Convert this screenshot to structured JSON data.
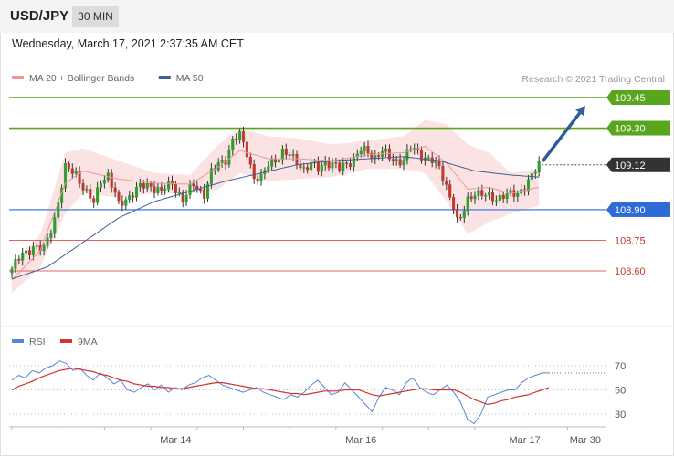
{
  "header": {
    "pair": "USD/JPY",
    "timeframe": "30 MIN",
    "datetime": "Wednesday, March 17, 2021 2:37:35 AM CET"
  },
  "copyright": "Research © 2021 Trading Central",
  "colors": {
    "candle_up": "#2f9e2f",
    "candle_down": "#c0392b",
    "bollinger_fill": "#fbe3e3",
    "ma20": "#e99999",
    "ma50": "#3f5f95",
    "resistance": "#5aa51e",
    "pivot": "#2f6bd6",
    "support": "#e06666",
    "current": "#333333",
    "arrow": "#2e5d9a",
    "rsi": "#5b84d4",
    "rsi_ma": "#d33333"
  },
  "chart_data": [
    {
      "type": "candlestick",
      "legend": [
        {
          "name": "MA 20 + Bollinger Bands",
          "color": "#e99999"
        },
        {
          "name": "MA 50",
          "color": "#3f5f95"
        }
      ],
      "ylim": [
        108.45,
        109.55
      ],
      "x_ticks": [
        {
          "label": "Mar 14",
          "index": 46
        },
        {
          "label": "Mar 16",
          "index": 98
        },
        {
          "label": "Mar 17",
          "index": 144
        },
        {
          "label": "Mar 30",
          "index": 161
        }
      ],
      "x_range": [
        0,
        162
      ],
      "levels": [
        {
          "label": "109.45",
          "value": 109.45,
          "role": "resistance"
        },
        {
          "label": "109.30",
          "value": 109.3,
          "role": "resistance"
        },
        {
          "label": "109.12",
          "value": 109.12,
          "role": "current"
        },
        {
          "label": "108.90",
          "value": 108.9,
          "role": "pivot"
        },
        {
          "label": "108.75",
          "value": 108.75,
          "role": "support"
        },
        {
          "label": "108.60",
          "value": 108.6,
          "role": "support"
        }
      ],
      "close_keypoints": [
        [
          0,
          108.61
        ],
        [
          3,
          108.68
        ],
        [
          6,
          108.72
        ],
        [
          9,
          108.7
        ],
        [
          12,
          108.86
        ],
        [
          15,
          109.1
        ],
        [
          18,
          109.08
        ],
        [
          21,
          108.98
        ],
        [
          23,
          108.93
        ],
        [
          25,
          109.05
        ],
        [
          27,
          109.07
        ],
        [
          30,
          108.92
        ],
        [
          33,
          108.97
        ],
        [
          36,
          109.01
        ],
        [
          39,
          109.02
        ],
        [
          42,
          108.99
        ],
        [
          45,
          109.03
        ],
        [
          48,
          108.95
        ],
        [
          51,
          109.02
        ],
        [
          54,
          108.98
        ],
        [
          56,
          109.08
        ],
        [
          58,
          109.12
        ],
        [
          60,
          109.15
        ],
        [
          62,
          109.24
        ],
        [
          64,
          109.26
        ],
        [
          66,
          109.18
        ],
        [
          68,
          109.06
        ],
        [
          70,
          109.05
        ],
        [
          72,
          109.12
        ],
        [
          74,
          109.15
        ],
        [
          76,
          109.18
        ],
        [
          78,
          109.16
        ],
        [
          80,
          109.14
        ],
        [
          82,
          109.1
        ],
        [
          84,
          109.12
        ],
        [
          86,
          109.1
        ],
        [
          88,
          109.14
        ],
        [
          90,
          109.12
        ],
        [
          92,
          109.1
        ],
        [
          94,
          109.13
        ],
        [
          96,
          109.15
        ],
        [
          98,
          109.19
        ],
        [
          100,
          109.18
        ],
        [
          102,
          109.16
        ],
        [
          104,
          109.19
        ],
        [
          106,
          109.15
        ],
        [
          108,
          109.14
        ],
        [
          110,
          109.15
        ],
        [
          112,
          109.2
        ],
        [
          114,
          109.18
        ],
        [
          116,
          109.16
        ],
        [
          118,
          109.14
        ],
        [
          120,
          109.1
        ],
        [
          122,
          109.02
        ],
        [
          124,
          108.92
        ],
        [
          125,
          108.84
        ],
        [
          126,
          108.85
        ],
        [
          128,
          108.95
        ],
        [
          130,
          108.99
        ],
        [
          132,
          108.97
        ],
        [
          134,
          108.96
        ],
        [
          136,
          108.96
        ],
        [
          138,
          108.97
        ],
        [
          140,
          108.97
        ],
        [
          142,
          108.98
        ],
        [
          144,
          109.02
        ],
        [
          146,
          109.06
        ],
        [
          148,
          109.12
        ]
      ],
      "ma50_keypoints": [
        [
          0,
          108.56
        ],
        [
          10,
          108.62
        ],
        [
          20,
          108.74
        ],
        [
          30,
          108.86
        ],
        [
          40,
          108.94
        ],
        [
          50,
          108.99
        ],
        [
          60,
          109.04
        ],
        [
          70,
          109.08
        ],
        [
          80,
          109.12
        ],
        [
          90,
          109.14
        ],
        [
          100,
          109.15
        ],
        [
          110,
          109.16
        ],
        [
          120,
          109.14
        ],
        [
          130,
          109.09
        ],
        [
          140,
          109.07
        ],
        [
          148,
          109.06
        ]
      ],
      "bollinger_keypoints": [
        [
          0,
          108.49,
          108.62
        ],
        [
          8,
          108.62,
          108.78
        ],
        [
          15,
          108.88,
          109.18
        ],
        [
          20,
          108.98,
          109.2
        ],
        [
          30,
          108.96,
          109.14
        ],
        [
          40,
          108.98,
          109.08
        ],
        [
          50,
          108.98,
          109.07
        ],
        [
          58,
          109.0,
          109.22
        ],
        [
          64,
          109.08,
          109.3
        ],
        [
          72,
          109.04,
          109.26
        ],
        [
          80,
          109.05,
          109.25
        ],
        [
          90,
          109.06,
          109.22
        ],
        [
          100,
          109.1,
          109.24
        ],
        [
          110,
          109.1,
          109.26
        ],
        [
          116,
          109.08,
          109.34
        ],
        [
          122,
          108.94,
          109.32
        ],
        [
          128,
          108.78,
          109.22
        ],
        [
          134,
          108.84,
          109.18
        ],
        [
          140,
          108.88,
          109.08
        ],
        [
          148,
          108.92,
          109.1
        ]
      ],
      "forecast_arrow": {
        "from": [
          148,
          109.12
        ],
        "to": [
          161,
          109.41
        ]
      }
    },
    {
      "type": "line",
      "legend": [
        {
          "name": "RSI",
          "color": "#5b84d4"
        },
        {
          "name": "9MA",
          "color": "#d33333"
        }
      ],
      "ylim": [
        20,
        80
      ],
      "y_ticks": [
        30,
        50,
        70
      ],
      "x_range": [
        0,
        162
      ],
      "series": [
        {
          "name": "RSI",
          "values": [
            58,
            62,
            60,
            66,
            64,
            68,
            70,
            74,
            72,
            66,
            68,
            62,
            58,
            64,
            60,
            55,
            58,
            50,
            48,
            52,
            55,
            50,
            54,
            48,
            52,
            50,
            54,
            56,
            60,
            62,
            58,
            54,
            52,
            50,
            48,
            50,
            52,
            48,
            46,
            44,
            42,
            46,
            44,
            48,
            54,
            58,
            52,
            46,
            48,
            56,
            50,
            44,
            38,
            32,
            44,
            52,
            50,
            46,
            56,
            60,
            52,
            48,
            46,
            50,
            54,
            48,
            40,
            26,
            22,
            30,
            44,
            46,
            48,
            50,
            50,
            56,
            60,
            62,
            64,
            64
          ]
        },
        {
          "name": "9MA",
          "values": [
            50,
            53,
            55,
            57,
            60,
            62,
            64,
            66,
            67,
            68,
            67,
            66,
            65,
            63,
            62,
            60,
            58,
            57,
            55,
            54,
            53,
            53,
            52,
            52,
            51,
            51,
            52,
            53,
            54,
            55,
            56,
            56,
            55,
            54,
            53,
            52,
            51,
            51,
            50,
            49,
            48,
            47,
            47,
            46,
            47,
            48,
            49,
            49,
            49,
            50,
            50,
            50,
            48,
            46,
            45,
            46,
            47,
            48,
            49,
            50,
            51,
            51,
            50,
            50,
            50,
            50,
            48,
            45,
            42,
            40,
            38,
            39,
            41,
            42,
            44,
            45,
            46,
            48,
            50,
            52
          ]
        }
      ]
    }
  ]
}
